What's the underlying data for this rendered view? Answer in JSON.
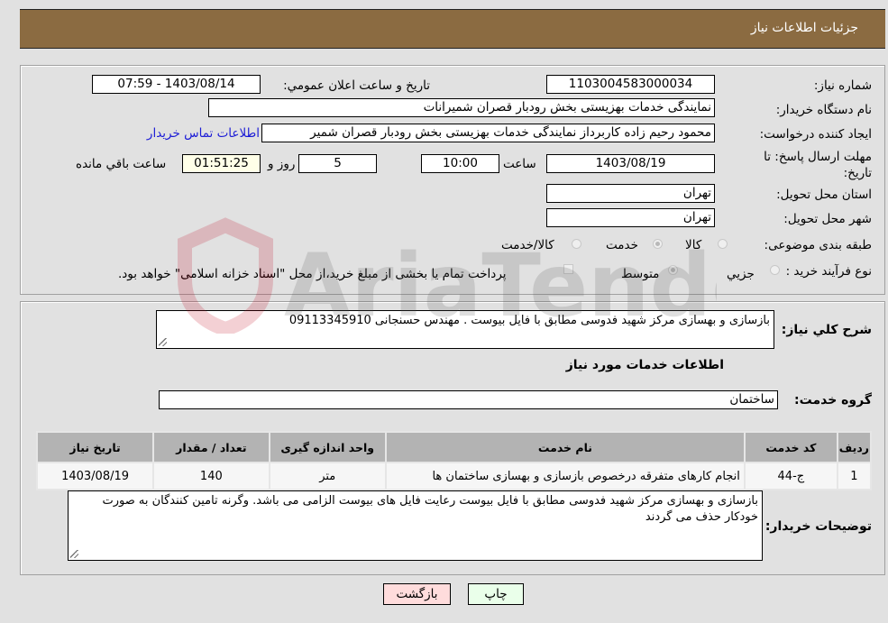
{
  "header": {
    "title": "جزئيات اطلاعات نياز"
  },
  "form": {
    "need_number_label": "شماره نیاز:",
    "need_number": "1103004583000034",
    "announce_label": "تاریخ و ساعت اعلان عمومي:",
    "announce_value": "1403/08/14 - 07:59",
    "buyer_org_label": "نام دستگاه خريدار:",
    "buyer_org": "نمایندگی خدمات بهزیستی بخش رودبار قصران   شمیرانات",
    "requester_label": "ايجاد کننده درخواست:",
    "requester": "محمود رحیم زاده کاربرداز نمایندگی خدمات بهزیستی بخش رودبار قصران   شمیر",
    "contact_link": "اطلاعات تماس خريدار",
    "deadline_label": "مهلت ارسال پاسخ: تا تاریخ:",
    "deadline_date": "1403/08/19",
    "time_label": "ساعت",
    "deadline_time": "10:00",
    "days": "5",
    "days_label": "روز و",
    "remaining": "01:51:25",
    "remaining_label": "ساعت باقي مانده",
    "province_label": "استان محل تحویل:",
    "province": "تهران",
    "city_label": "شهر محل تحویل:",
    "city": "تهران",
    "category_label": "طبقه بندی موضوعی:",
    "category_options": [
      {
        "label": "کالا",
        "selected": false
      },
      {
        "label": "خدمت",
        "selected": true
      },
      {
        "label": "کالا/خدمت",
        "selected": false
      }
    ],
    "process_label": "نوع فرآیند خرید :",
    "process_options": [
      {
        "label": "جزيي",
        "selected": false
      },
      {
        "label": "متوسط",
        "selected": true
      }
    ],
    "treasury_checkbox_label": "پرداخت تمام یا بخشی از مبلغ خرید،از محل \"اسناد خزانه اسلامی\" خواهد بود.",
    "treasury_checked": false
  },
  "details": {
    "summary_label": "شرح كلي نياز:",
    "summary": "بازسازی و بهسازی مرکز شهید فدوسی مطابق با فایل بیوست  . مهندس حسنجانی 09113345910",
    "services_heading": "اطلاعات خدمات مورد نیاز",
    "service_group_label": "گروه خدمت:",
    "service_group": "ساختمان",
    "table": {
      "headers": [
        "رديف",
        "کد خدمت",
        "نام خدمت",
        "واحد اندازه گیری",
        "تعداد / مقدار",
        "تاریخ نیاز"
      ],
      "rows": [
        [
          "1",
          "ج-44",
          "انجام کارهای متفرقه درخصوص بازسازی و بهسازی ساختمان ها",
          "متر",
          "140",
          "1403/08/19"
        ]
      ]
    },
    "buyer_notes_label": "توضیحات خریدار:",
    "buyer_notes": "بازسازی و بهسازی مرکز شهید فدوسی مطابق با فایل بیوست رعایت فایل های بیوست الزامی می باشد. وگرنه تامین کنندگان به صورت خودکار حذف می گردند"
  },
  "buttons": {
    "print": "چاپ",
    "back": "بازگشت"
  },
  "watermark": {
    "text": "AriaTender.neT"
  },
  "colors": {
    "header_bg": "#8b6b41",
    "print_bg": "#eaffea",
    "back_bg": "#ffdcdc",
    "link": "#1b1bd6"
  }
}
